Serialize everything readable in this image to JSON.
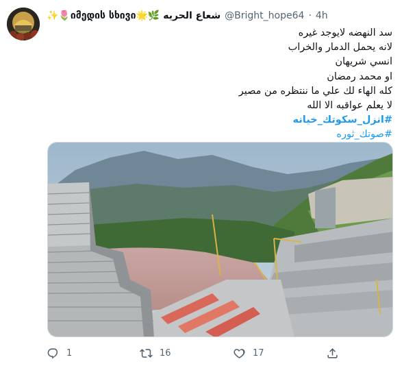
{
  "tweet": {
    "display_name": "✨🌷იმედის სხივი🌟🌿 شعاع الحريه",
    "handle": "@Bright_hope64",
    "separator": "·",
    "time": "4h",
    "lines": [
      "سد النهضه لايوجد غيره",
      "لانه يحمل الدمار والخراب",
      "انسي شريهان",
      "او محمد رمضان",
      "كله الهاء لك علي ما ننتظره من مصير",
      "لا يعلم عواقبه الا الله"
    ],
    "hashtags": [
      "#انزل_سكوتك_خيانه",
      "#صوتك_ثوره"
    ]
  },
  "actions": {
    "reply_count": "1",
    "retweet_count": "16",
    "like_count": "17"
  },
  "icons": {
    "reply": "reply-icon",
    "retweet": "retweet-icon",
    "like": "heart-icon",
    "share": "share-icon"
  },
  "colors": {
    "link": "#1d9bf0",
    "secondary_text": "#536471",
    "primary_text": "#0f1419"
  }
}
